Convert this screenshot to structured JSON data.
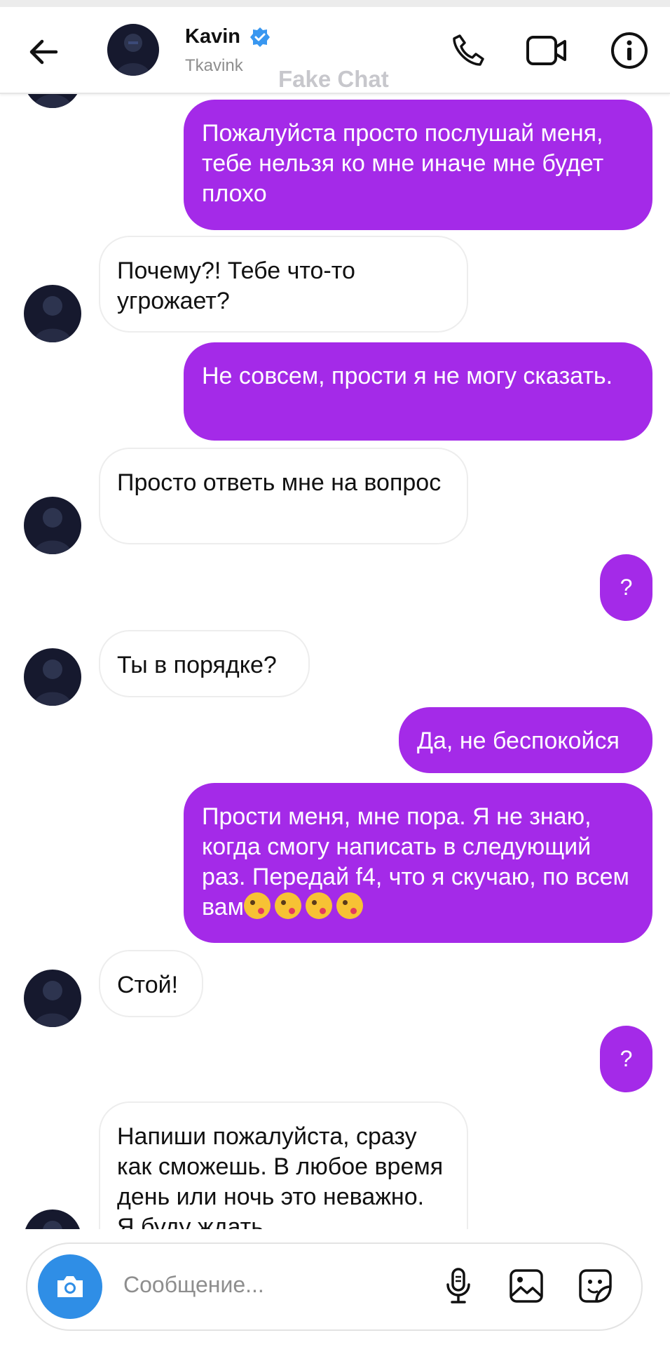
{
  "header": {
    "name": "Kavin",
    "username": "Tkavink",
    "watermark": "Fake Chat",
    "back_icon": "arrow-left-icon",
    "call_icon": "phone-icon",
    "video_icon": "video-camera-icon",
    "info_icon": "info-circle-icon",
    "verified_color": "#3897f0"
  },
  "messages": [
    {
      "side": "out",
      "text": "Пожалуйста просто послушай меня, тебе нельзя ко мне иначе мне будет плохо"
    },
    {
      "side": "in",
      "text": "Почему?! Тебе что-то угрожает?"
    },
    {
      "side": "out",
      "text": "Не совсем, прости я не могу сказать."
    },
    {
      "side": "in",
      "text": "Просто ответь мне на вопрос"
    },
    {
      "side": "out",
      "text": "?"
    },
    {
      "side": "in",
      "text": "Ты в порядке?"
    },
    {
      "side": "out",
      "text": "Да, не беспокойся"
    },
    {
      "side": "out",
      "text": "Прости меня, мне пора. Я не знаю, когда смогу написать в следующий раз. Передай f4, что я скучаю, по всем вам",
      "emoji": "kissing-face-emoji",
      "emoji_count": 4
    },
    {
      "side": "in",
      "text": "Стой!"
    },
    {
      "side": "out",
      "text": "?"
    },
    {
      "side": "in",
      "text": "Напиши пожалуйста, сразу как сможешь. В любое время день или ночь это неважно. Я буду ждать"
    }
  ],
  "composer": {
    "placeholder": "Сообщение...",
    "camera_icon": "camera-icon",
    "mic_icon": "microphone-icon",
    "gallery_icon": "image-icon",
    "sticker_icon": "sticker-icon"
  },
  "colors": {
    "outgoing_bubble": "#a42ae8",
    "incoming_bubble": "#ffffff",
    "camera_button": "#2f8ee6"
  }
}
